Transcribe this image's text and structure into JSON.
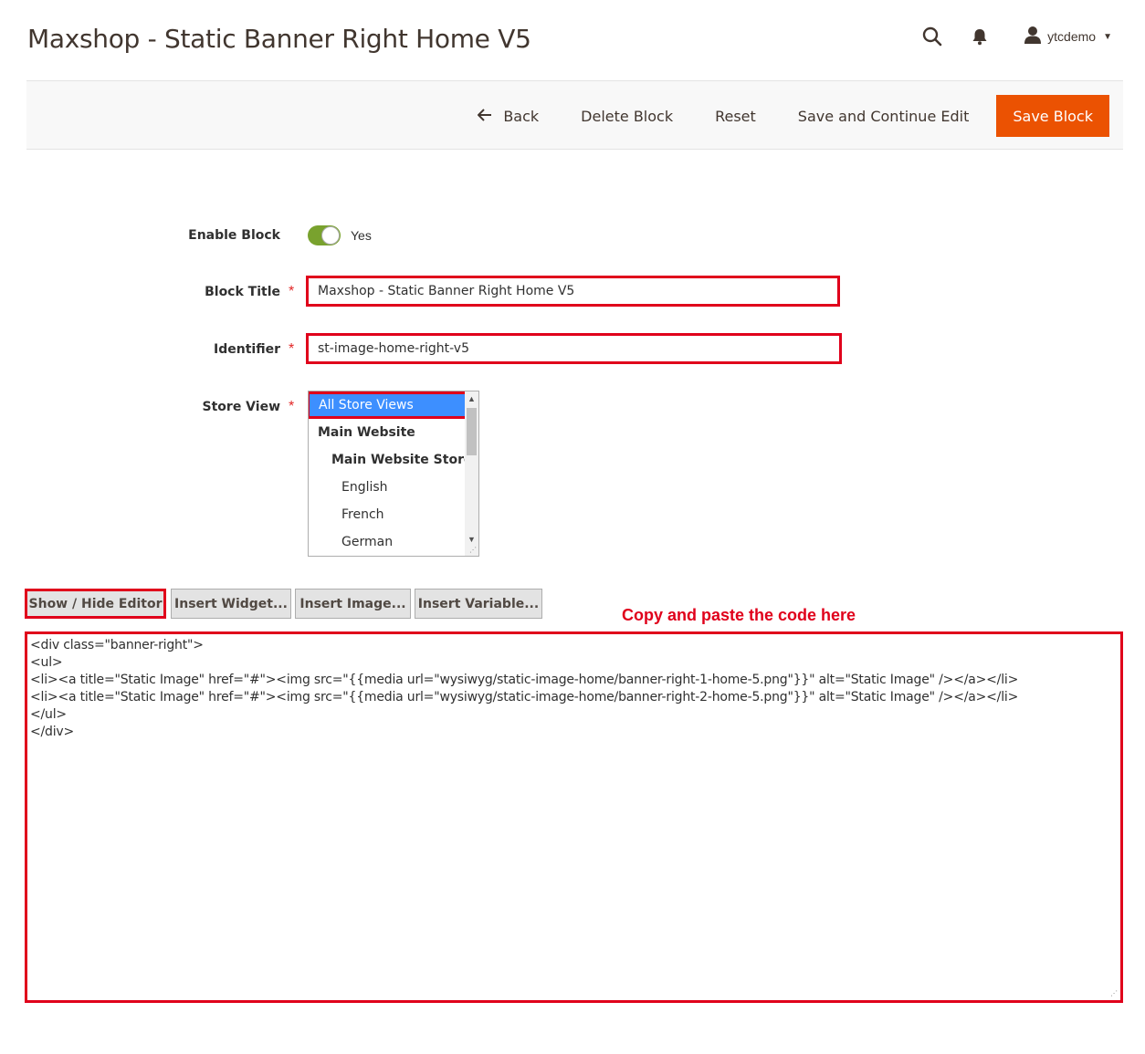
{
  "page": {
    "title": "Maxshop - Static Banner Right Home V5"
  },
  "header": {
    "user_name": "ytcdemo",
    "icons": [
      "search-icon",
      "bell-icon",
      "user-icon",
      "caret-down-icon"
    ]
  },
  "action_bar": {
    "back_label": "Back",
    "delete_label": "Delete Block",
    "reset_label": "Reset",
    "save_continue_label": "Save and Continue Edit",
    "save_label": "Save Block",
    "save_color": "#eb5202"
  },
  "form": {
    "enable": {
      "label": "Enable Block",
      "value_text": "Yes",
      "on": true
    },
    "title": {
      "label": "Block Title",
      "value": "Maxshop - Static Banner Right Home V5"
    },
    "identifier": {
      "label": "Identifier",
      "value": "st-image-home-right-v5"
    },
    "store_view": {
      "label": "Store View",
      "options": [
        "All Store Views",
        "Main Website",
        "Main Website Store",
        "English",
        "French",
        "German"
      ],
      "selected": "All Store Views"
    },
    "required_mark": "*"
  },
  "editor": {
    "show_hide_label": "Show / Hide Editor",
    "insert_widget_label": "Insert Widget...",
    "insert_image_label": "Insert Image...",
    "insert_variable_label": "Insert Variable...",
    "annotation": "Copy and paste the code here",
    "code_lines": [
      "<div class=\"banner-right\">",
      "<ul>",
      "<li><a title=\"Static Image\" href=\"#\"><img src=\"{{media url=\"wysiwyg/static-image-home/banner-right-1-home-5.png\"}}\" alt=\"Static Image\" /></a></li>",
      "<li><a title=\"Static Image\" href=\"#\"><img src=\"{{media url=\"wysiwyg/static-image-home/banner-right-2-home-5.png\"}}\" alt=\"Static Image\" /></a></li>",
      "</ul>",
      "</div>"
    ]
  },
  "colors": {
    "accent": "#eb5202",
    "toggle_on": "#79a22e",
    "highlight": "#e0001b",
    "selected_option": "#3d8fff"
  }
}
